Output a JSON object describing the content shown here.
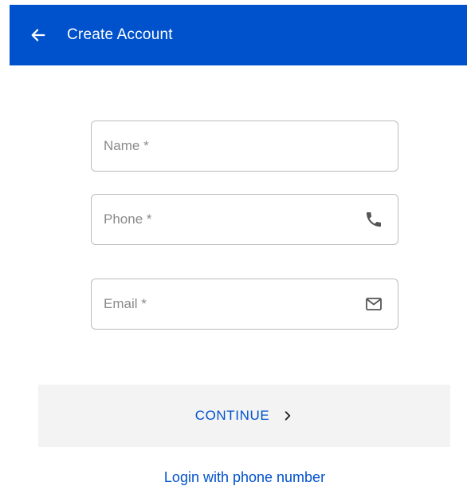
{
  "header": {
    "title": "Create Account",
    "back_icon": "arrow-left-icon",
    "background": "#0052cc"
  },
  "form": {
    "name": {
      "placeholder": "Name *",
      "value": ""
    },
    "phone": {
      "placeholder": "Phone *",
      "value": "",
      "icon": "phone-icon"
    },
    "email": {
      "placeholder": "Email *",
      "value": "",
      "icon": "mail-icon"
    }
  },
  "continue_button": {
    "label": "CONTINUE",
    "icon": "chevron-right-icon"
  },
  "login_link": {
    "label": "Login with phone number"
  },
  "colors": {
    "accent": "#0052cc",
    "button_bg": "#f3f3f3",
    "border": "#bdbdbd"
  }
}
